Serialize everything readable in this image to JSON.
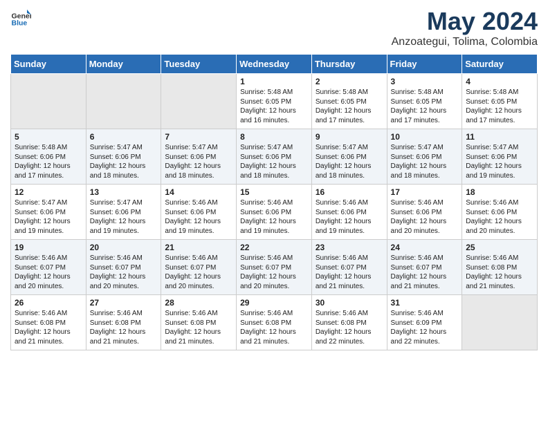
{
  "header": {
    "logo_general": "General",
    "logo_blue": "Blue",
    "title": "May 2024",
    "subtitle": "Anzoategui, Tolima, Colombia"
  },
  "days_of_week": [
    "Sunday",
    "Monday",
    "Tuesday",
    "Wednesday",
    "Thursday",
    "Friday",
    "Saturday"
  ],
  "weeks": [
    [
      {
        "day": "",
        "content": ""
      },
      {
        "day": "",
        "content": ""
      },
      {
        "day": "",
        "content": ""
      },
      {
        "day": "1",
        "content": "Sunrise: 5:48 AM\nSunset: 6:05 PM\nDaylight: 12 hours\nand 16 minutes."
      },
      {
        "day": "2",
        "content": "Sunrise: 5:48 AM\nSunset: 6:05 PM\nDaylight: 12 hours\nand 17 minutes."
      },
      {
        "day": "3",
        "content": "Sunrise: 5:48 AM\nSunset: 6:05 PM\nDaylight: 12 hours\nand 17 minutes."
      },
      {
        "day": "4",
        "content": "Sunrise: 5:48 AM\nSunset: 6:05 PM\nDaylight: 12 hours\nand 17 minutes."
      }
    ],
    [
      {
        "day": "5",
        "content": "Sunrise: 5:48 AM\nSunset: 6:06 PM\nDaylight: 12 hours\nand 17 minutes."
      },
      {
        "day": "6",
        "content": "Sunrise: 5:47 AM\nSunset: 6:06 PM\nDaylight: 12 hours\nand 18 minutes."
      },
      {
        "day": "7",
        "content": "Sunrise: 5:47 AM\nSunset: 6:06 PM\nDaylight: 12 hours\nand 18 minutes."
      },
      {
        "day": "8",
        "content": "Sunrise: 5:47 AM\nSunset: 6:06 PM\nDaylight: 12 hours\nand 18 minutes."
      },
      {
        "day": "9",
        "content": "Sunrise: 5:47 AM\nSunset: 6:06 PM\nDaylight: 12 hours\nand 18 minutes."
      },
      {
        "day": "10",
        "content": "Sunrise: 5:47 AM\nSunset: 6:06 PM\nDaylight: 12 hours\nand 18 minutes."
      },
      {
        "day": "11",
        "content": "Sunrise: 5:47 AM\nSunset: 6:06 PM\nDaylight: 12 hours\nand 19 minutes."
      }
    ],
    [
      {
        "day": "12",
        "content": "Sunrise: 5:47 AM\nSunset: 6:06 PM\nDaylight: 12 hours\nand 19 minutes."
      },
      {
        "day": "13",
        "content": "Sunrise: 5:47 AM\nSunset: 6:06 PM\nDaylight: 12 hours\nand 19 minutes."
      },
      {
        "day": "14",
        "content": "Sunrise: 5:46 AM\nSunset: 6:06 PM\nDaylight: 12 hours\nand 19 minutes."
      },
      {
        "day": "15",
        "content": "Sunrise: 5:46 AM\nSunset: 6:06 PM\nDaylight: 12 hours\nand 19 minutes."
      },
      {
        "day": "16",
        "content": "Sunrise: 5:46 AM\nSunset: 6:06 PM\nDaylight: 12 hours\nand 19 minutes."
      },
      {
        "day": "17",
        "content": "Sunrise: 5:46 AM\nSunset: 6:06 PM\nDaylight: 12 hours\nand 20 minutes."
      },
      {
        "day": "18",
        "content": "Sunrise: 5:46 AM\nSunset: 6:06 PM\nDaylight: 12 hours\nand 20 minutes."
      }
    ],
    [
      {
        "day": "19",
        "content": "Sunrise: 5:46 AM\nSunset: 6:07 PM\nDaylight: 12 hours\nand 20 minutes."
      },
      {
        "day": "20",
        "content": "Sunrise: 5:46 AM\nSunset: 6:07 PM\nDaylight: 12 hours\nand 20 minutes."
      },
      {
        "day": "21",
        "content": "Sunrise: 5:46 AM\nSunset: 6:07 PM\nDaylight: 12 hours\nand 20 minutes."
      },
      {
        "day": "22",
        "content": "Sunrise: 5:46 AM\nSunset: 6:07 PM\nDaylight: 12 hours\nand 20 minutes."
      },
      {
        "day": "23",
        "content": "Sunrise: 5:46 AM\nSunset: 6:07 PM\nDaylight: 12 hours\nand 21 minutes."
      },
      {
        "day": "24",
        "content": "Sunrise: 5:46 AM\nSunset: 6:07 PM\nDaylight: 12 hours\nand 21 minutes."
      },
      {
        "day": "25",
        "content": "Sunrise: 5:46 AM\nSunset: 6:08 PM\nDaylight: 12 hours\nand 21 minutes."
      }
    ],
    [
      {
        "day": "26",
        "content": "Sunrise: 5:46 AM\nSunset: 6:08 PM\nDaylight: 12 hours\nand 21 minutes."
      },
      {
        "day": "27",
        "content": "Sunrise: 5:46 AM\nSunset: 6:08 PM\nDaylight: 12 hours\nand 21 minutes."
      },
      {
        "day": "28",
        "content": "Sunrise: 5:46 AM\nSunset: 6:08 PM\nDaylight: 12 hours\nand 21 minutes."
      },
      {
        "day": "29",
        "content": "Sunrise: 5:46 AM\nSunset: 6:08 PM\nDaylight: 12 hours\nand 21 minutes."
      },
      {
        "day": "30",
        "content": "Sunrise: 5:46 AM\nSunset: 6:08 PM\nDaylight: 12 hours\nand 22 minutes."
      },
      {
        "day": "31",
        "content": "Sunrise: 5:46 AM\nSunset: 6:09 PM\nDaylight: 12 hours\nand 22 minutes."
      },
      {
        "day": "",
        "content": ""
      }
    ]
  ]
}
